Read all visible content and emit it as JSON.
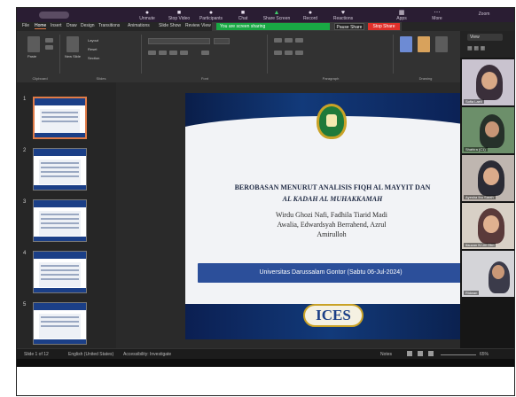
{
  "zoom_controls": {
    "items": [
      "Unmute",
      "Stop Video",
      "Participants",
      "Chat",
      "Share Screen",
      "Record",
      "Reactions",
      "Apps",
      "More"
    ],
    "window_label": "Zoom"
  },
  "office_tabs": [
    "File",
    "Home",
    "Insert",
    "Draw",
    "Design",
    "Transitions",
    "Animations",
    "Slide Show",
    "Review",
    "View"
  ],
  "share_banner": {
    "text": "You are screen sharing",
    "more_label": "Pause Share",
    "stop_label": "Stop Share"
  },
  "ribbon_groups": [
    "Clipboard",
    "Slides",
    "Font",
    "Paragraph",
    "Drawing"
  ],
  "ribbon_buttons": {
    "paste": "Paste",
    "new_slide": "New Slide",
    "layout": "Layout",
    "reset": "Reset",
    "section": "Section"
  },
  "thumbnails": [
    {
      "num": "1"
    },
    {
      "num": "2"
    },
    {
      "num": "3"
    },
    {
      "num": "4"
    },
    {
      "num": "5"
    }
  ],
  "slide": {
    "title_line1": "BEROBASAN MENURUT ANALISIS FIQH AL MAYYIT DAN",
    "title_line2": "AL KADAH AL MUHAKKAMAH",
    "authors_line1": "Wirdu Ghozi Nafi, Fadhila Tiarid Madi",
    "authors_line2": "Awalia, Edwardsyah Berrahend, Azrul",
    "authors_line3": "Amirulloh",
    "banner": "Universitas Darussalam Gontor (Sabtu 06-Jul-2024)",
    "logo_text": "ICES"
  },
  "participants": {
    "header": "View",
    "tiles": [
      {
        "name": "Sofia Laeli"
      },
      {
        "name": "Shahira (C1)"
      },
      {
        "name": "Ayesha Ibu Sarah"
      },
      {
        "name": "Ifauzan N.Ulil Ohn"
      },
      {
        "name": "Ridwan"
      }
    ]
  },
  "status_bar": {
    "slide_info": "Slide 1 of 12",
    "language": "English (United States)",
    "accessibility": "Accessibility: Investigate",
    "notes": "Notes",
    "zoom_pct": "65%"
  },
  "colors": {
    "slide_navy": "#123a7a",
    "banner_blue": "#2c4f9a",
    "share_green": "#19a844",
    "stop_red": "#e0302a",
    "selected_thumb": "#e07b47"
  }
}
